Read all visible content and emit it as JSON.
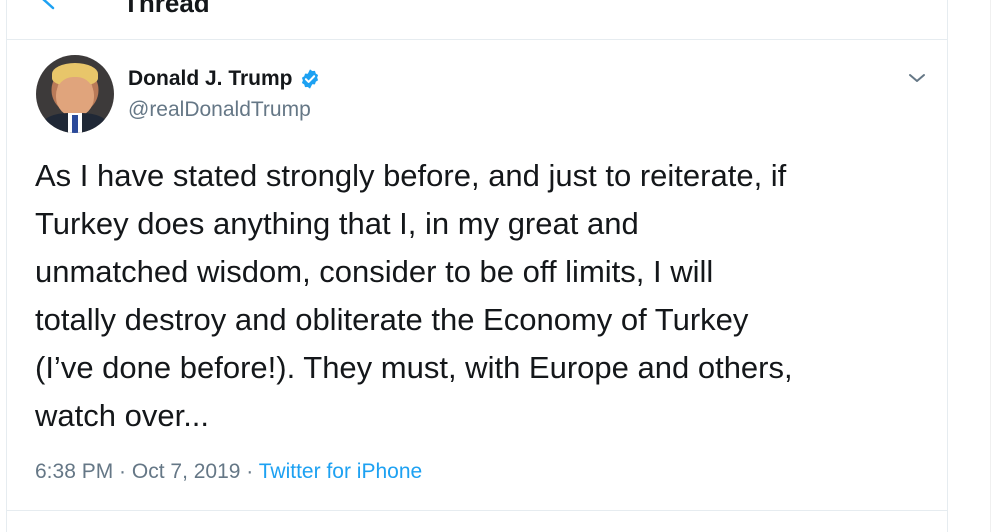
{
  "header": {
    "back_icon": "back-arrow-icon",
    "title": "Thread"
  },
  "tweet": {
    "author": {
      "name": "Donald J. Trump",
      "handle": "@realDonaldTrump",
      "verified_icon": "verified-badge-icon",
      "avatar": "profile-photo"
    },
    "menu_icon": "chevron-down-icon",
    "text": "As I have stated strongly before, and just to reiterate, if\nTurkey does anything that I, in my great and\nunmatched wisdom, consider to be off limits, I will\ntotally destroy and obliterate the Economy of Turkey\n(I’ve done before!). They must, with Europe and others,\nwatch over...",
    "time": "6:38 PM",
    "separator": " · ",
    "date": "Oct 7, 2019",
    "source": "Twitter for iPhone"
  },
  "colors": {
    "accent": "#1da1f2",
    "text": "#14171a",
    "muted": "#657786",
    "border": "#e6ecf0"
  }
}
